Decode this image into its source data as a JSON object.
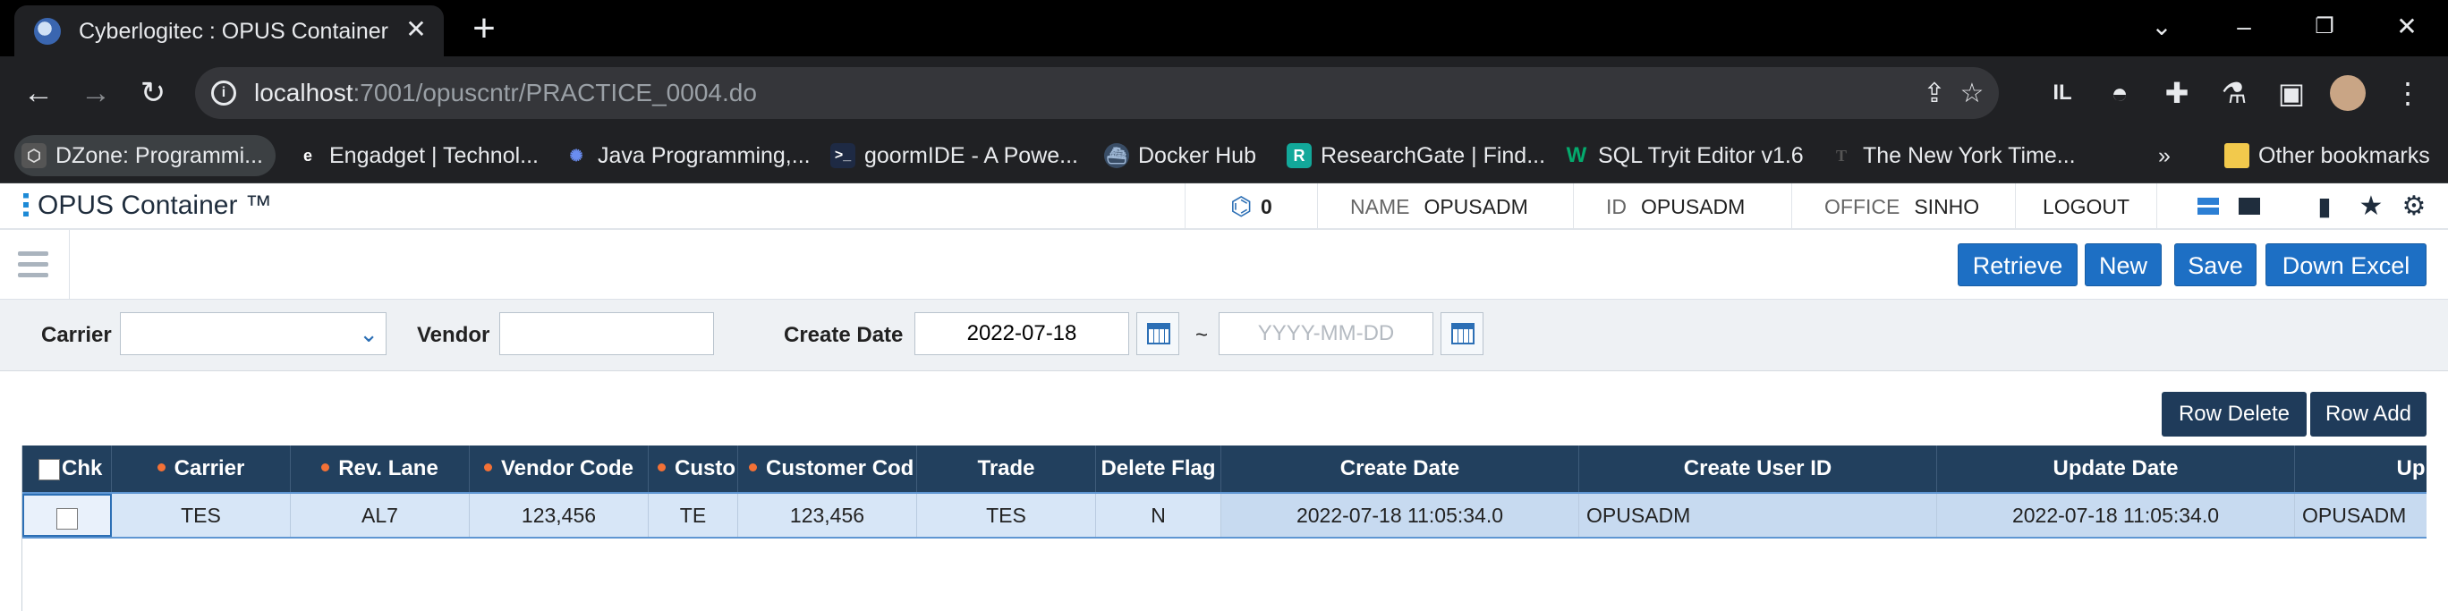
{
  "browser": {
    "tab_title": "Cyberlogitec : OPUS Container",
    "url_host": "localhost",
    "url_path": ":7001/opuscntr/PRACTICE_0004.do",
    "bookmarks": [
      "DZone: Programmi...",
      "Engadget | Technol...",
      "Java Programming,...",
      "goormIDE - A Powe...",
      "Docker Hub",
      "ResearchGate | Find...",
      "SQL Tryit Editor v1.6",
      "The New York Time..."
    ],
    "other_bookmarks": "Other bookmarks"
  },
  "app": {
    "logo": "OPUS Container ™",
    "notification_count": "0",
    "user": {
      "name_label": "NAME",
      "name_value": "OPUSADM",
      "id_label": "ID",
      "id_value": "OPUSADM",
      "office_label": "OFFICE",
      "office_value": "SINHO"
    },
    "logout": "LOGOUT",
    "toolbar": {
      "retrieve": "Retrieve",
      "new": "New",
      "save": "Save",
      "down_excel": "Down Excel"
    },
    "search": {
      "carrier_label": "Carrier",
      "carrier_value": "",
      "vendor_label": "Vendor",
      "vendor_value": "",
      "create_date_label": "Create Date",
      "date_from": "2022-07-18",
      "date_separator": "~",
      "date_to_placeholder": "YYYY-MM-DD"
    },
    "grid_buttons": {
      "row_delete": "Row Delete",
      "row_add": "Row Add"
    },
    "grid": {
      "headers": [
        "Chk",
        "Carrier",
        "Rev. Lane",
        "Vendor Code",
        "Custo",
        "Customer Cod",
        "Trade",
        "Delete Flag",
        "Create Date",
        "Create User ID",
        "Update Date",
        "Up"
      ],
      "rows": [
        [
          "",
          "TES",
          "AL7",
          "123,456",
          "TE",
          "123,456",
          "TES",
          "N",
          "2022-07-18 11:05:34.0",
          "OPUSADM",
          "2022-07-18 11:05:34.0",
          "OPUSADM"
        ]
      ]
    }
  }
}
